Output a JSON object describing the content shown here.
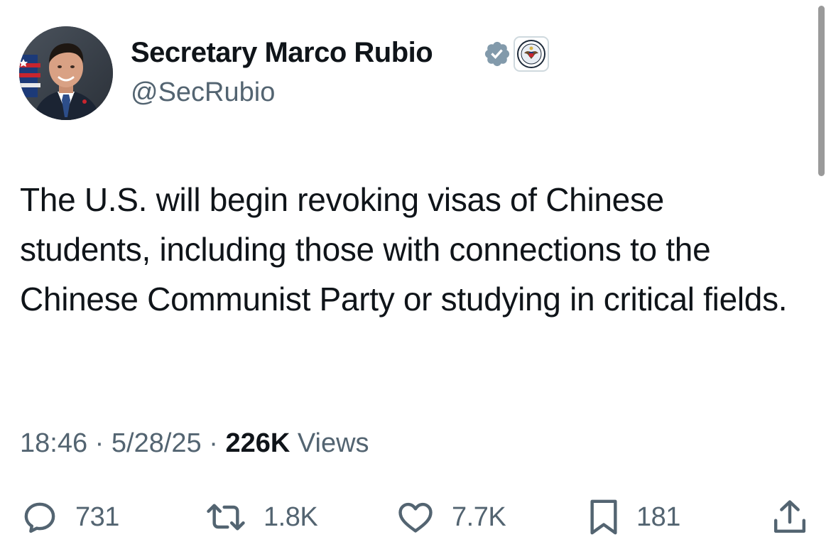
{
  "author": {
    "display_name": "Secretary Marco Rubio",
    "handle": "@SecRubio",
    "verified_icon": "verified-badge-icon",
    "affiliate_icon": "state-department-seal-icon"
  },
  "post": {
    "text": "The U.S. will begin revoking visas of Chinese students, including those with connections to the Chinese Communist Party or studying in critical fields."
  },
  "meta": {
    "time": "18:46",
    "separator": "·",
    "date": "5/28/25",
    "views_count": "226K",
    "views_label": "Views"
  },
  "actions": {
    "replies": "731",
    "reposts": "1.8K",
    "likes": "7.7K",
    "bookmarks": "181"
  },
  "colors": {
    "text_primary": "#0f1419",
    "text_secondary": "#536471",
    "verified_badge": "#829aab"
  }
}
